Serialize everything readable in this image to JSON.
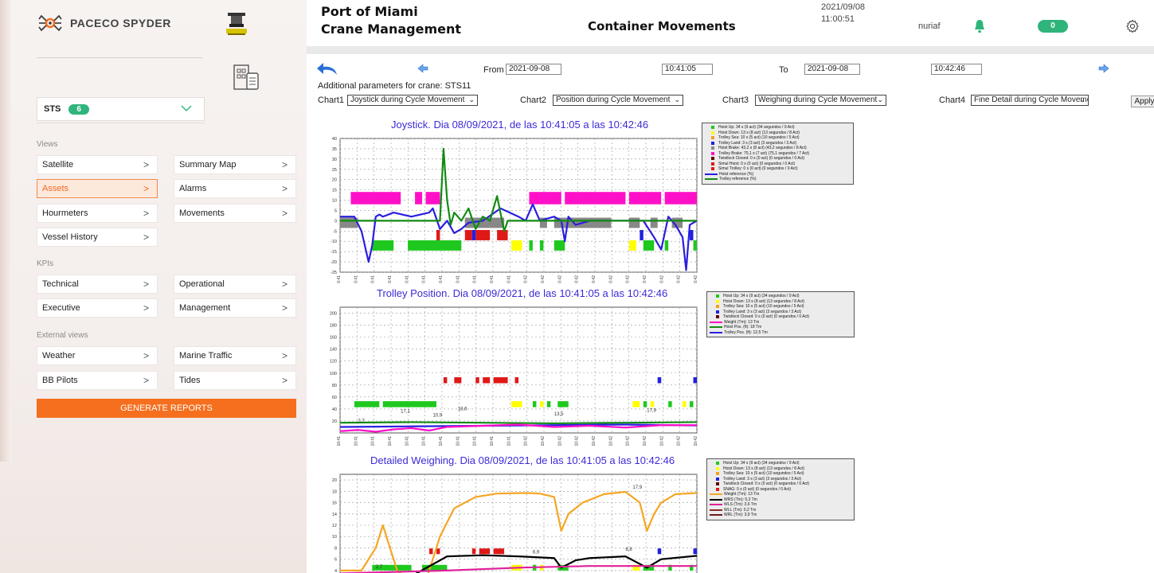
{
  "brand": {
    "name": "PACECO SPYDER"
  },
  "crane_selector": {
    "label": "STS",
    "count": "6"
  },
  "sections": {
    "views": "Views",
    "kpis": "KPIs",
    "external": "External views"
  },
  "nav": {
    "satellite": "Satellite",
    "summary_map": "Summary Map",
    "assets": "Assets",
    "alarms": "Alarms",
    "hourmeters": "Hourmeters",
    "movements": "Movements",
    "vessel_history": "Vessel History",
    "technical": "Technical",
    "operational": "Operational",
    "executive": "Executive",
    "management": "Management",
    "weather": "Weather",
    "marine_traffic": "Marine Traffic",
    "bb_pilots": "BB Pilots",
    "tides": "Tides",
    "arrow": ">"
  },
  "generate_reports": "GENERATE REPORTS",
  "header": {
    "port_line1": "Port of Miami",
    "port_line2": "Crane Management",
    "page_title": "Container Movements",
    "date": "2021/09/08",
    "time": "11:00:51",
    "user": "nuriaf",
    "notifications": "0"
  },
  "filters": {
    "from_label": "From",
    "from_date": "2021-09-08",
    "from_time": "10:41:05",
    "to_label": "To",
    "to_date": "2021-09-08",
    "to_time": "10:42:46",
    "additional": "Additional parameters for crane: STS11",
    "chart1_label": "Chart1",
    "chart1_value": "Joystick during Cycle Movement",
    "chart2_label": "Chart2",
    "chart2_value": "Position during Cycle Movement",
    "chart3_label": "Chart3",
    "chart3_value": "Weighing during Cycle Movement",
    "chart4_label": "Chart4",
    "chart4_value": "Fine Detail during Cycle Movement",
    "apply": "Apply"
  },
  "colors": {
    "accent": "#f56f1e",
    "green": "#2fb47c",
    "title_blue": "#3b2bd6"
  },
  "chart_data": [
    {
      "type": "line",
      "title": "Joystick. Dia 08/09/2021, de las 10:41:05 a las 10:42:46",
      "yticks": [
        "40",
        "35",
        "30",
        "25",
        "20",
        "15",
        "10",
        "5",
        "0",
        "-5",
        "-10",
        "-15",
        "-20",
        "-25"
      ],
      "ylim": [
        -25,
        40
      ],
      "xtick_labels": [
        "10:41",
        "10:41",
        "10:41",
        "10:41",
        "10:41",
        "10:41",
        "10:41",
        "10:41",
        "10:41",
        "10:41",
        "10:41",
        "10:42",
        "10:42",
        "10:42",
        "10:42",
        "10:42",
        "10:42",
        "10:42",
        "10:42",
        "10:42",
        "10:42",
        "10:42"
      ],
      "grid": true,
      "legend_position": "right",
      "legend": [
        {
          "label": "Hoist Up: 34 s (9 act) (34 segundos / 9 Act)",
          "color": "#1ec81e"
        },
        {
          "label": "Hoist Down: 13 s (8 act) (13 segundos / 8 Act)",
          "color": "#ffff00"
        },
        {
          "label": "Trolley Sea: 10 s (5 act) (10 segundos / 5 Act)",
          "color": "#f0a020"
        },
        {
          "label": "Trolley Land: 3 s (3 act) (3 segundos / 3 Act)",
          "color": "#2020e0"
        },
        {
          "label": "Hoist Brake: 43,2 s (8 act) (43,2 segundos / 8 Act)",
          "color": "#888888"
        },
        {
          "label": "Trolley Brake: 75,1 s (7 act) (75,1 segundos / 7 Act)",
          "color": "#ff10c8"
        },
        {
          "label": "Twistlock Closed: 0 s (0 act) (0 segundos / 0 Act)",
          "color": "#600000"
        },
        {
          "label": "Simul Hoist: 0 s (0 act) (0 segundos / 0 Act)",
          "color": "#e01818"
        },
        {
          "label": "Simul Trolley: 0 s (0 act) (0 segundos / 0 Act)",
          "color": "#e01818"
        },
        {
          "label": "Hoist reference (%)",
          "color": "#2a1ee0",
          "line": true
        },
        {
          "label": "Trolley reference (%)",
          "color": "#138a13",
          "line": true
        }
      ],
      "series": [
        {
          "name": "Hoist reference (%)",
          "color": "#2a1ee0",
          "x": [
            0,
            4,
            6,
            8,
            9,
            10,
            11,
            12,
            15,
            20,
            25,
            26,
            28,
            30,
            32,
            34,
            36,
            40,
            45,
            50,
            52,
            54,
            55,
            56,
            60,
            62,
            63,
            64,
            66,
            70,
            72,
            80,
            85,
            88,
            90,
            92,
            94,
            96,
            97,
            98,
            100
          ],
          "y": [
            2,
            2,
            -5,
            -20,
            -12,
            2,
            3,
            2,
            4,
            2,
            4,
            6,
            -4,
            0,
            -6,
            -4,
            -1,
            0,
            6,
            2,
            0,
            8,
            4,
            0,
            2,
            0,
            -10,
            2,
            -2,
            0,
            0,
            0,
            0,
            -8,
            -14,
            2,
            -2,
            -8,
            -24,
            -2,
            0
          ]
        },
        {
          "name": "Trolley reference (%)",
          "color": "#138a13",
          "x": [
            0,
            28,
            29,
            30,
            31,
            32,
            34,
            36,
            38,
            40,
            42,
            44,
            46,
            47,
            48,
            50,
            52,
            100
          ],
          "y": [
            0,
            0,
            35,
            10,
            -2,
            4,
            0,
            6,
            -4,
            2,
            0,
            12,
            -5,
            0,
            0,
            0,
            0,
            0
          ]
        }
      ]
    },
    {
      "type": "line",
      "title": "Trolley Position. Dia 08/09/2021, de las 10:41:05 a las 10:42:46",
      "yticks": [
        "200",
        "180",
        "160",
        "140",
        "120",
        "100",
        "80",
        "60",
        "40",
        "20"
      ],
      "ylim": [
        0,
        210
      ],
      "xtick_labels": [
        "10:41",
        "10:41",
        "10:41",
        "10:41",
        "10:41",
        "10:41",
        "10:41",
        "10:41",
        "10:41",
        "10:41",
        "10:41",
        "10:42",
        "10:42",
        "10:42",
        "10:42",
        "10:42",
        "10:42",
        "10:42",
        "10:42",
        "10:42",
        "10:42",
        "10:42"
      ],
      "annotations": [
        "17,1",
        "10,9",
        "18,6",
        "13,5",
        "17,9",
        "2,7"
      ],
      "grid": true,
      "legend_position": "right",
      "legend": [
        {
          "label": "Hoist Up: 34 s (9 act) (34 segundos / 9 Act)",
          "color": "#1ec81e"
        },
        {
          "label": "Hoist Down: 13 s (8 act) (13 segundos / 8 Act)",
          "color": "#ffff00"
        },
        {
          "label": "Trolley Sea: 10 s (5 act) (10 segundos / 5 Act)",
          "color": "#f0a020"
        },
        {
          "label": "Trolley Land: 3 s (3 act) (3 segundos / 3 Act)",
          "color": "#2020e0"
        },
        {
          "label": "Twistlock Closed: 0 s (0 act) (0 segundos / 0 Act)",
          "color": "#600000"
        },
        {
          "label": "Weight (Tm): 13 Tm",
          "color": "#ff10c8",
          "line": true
        },
        {
          "label": "Hoist Pos. (ft): 18 Tm",
          "color": "#138a13",
          "line": true
        },
        {
          "label": "Trolley Pos. (ft): 12,5 Tm",
          "color": "#2a1ee0",
          "line": true
        }
      ],
      "series": [
        {
          "name": "Hoist Pos. (ft): 18 Tm",
          "color": "#138a13",
          "x": [
            0,
            20,
            40,
            60,
            80,
            100
          ],
          "y": [
            17,
            18,
            17,
            16,
            17,
            18
          ]
        },
        {
          "name": "Trolley Pos. (ft): 12,5 Tm",
          "color": "#2a1ee0",
          "x": [
            0,
            20,
            40,
            60,
            80,
            100
          ],
          "y": [
            10,
            11,
            12,
            13,
            14,
            12.5
          ]
        },
        {
          "name": "Weight (Tm): 13 Tm",
          "color": "#ff10c8",
          "x": [
            0,
            5,
            10,
            15,
            20,
            25,
            30,
            40,
            50,
            60,
            70,
            80,
            90,
            100
          ],
          "y": [
            3,
            5,
            2,
            6,
            8,
            4,
            10,
            12,
            14,
            10,
            12,
            9,
            13,
            13
          ]
        }
      ]
    },
    {
      "type": "line",
      "title": "Detailed Weighing. Dia 08/09/2021, de las 10:41:05 a las 10:42:46",
      "yticks": [
        "20",
        "18",
        "16",
        "14",
        "12",
        "10",
        "8",
        "6",
        "4"
      ],
      "ylim": [
        3,
        21
      ],
      "annotations": [
        "17,9",
        "6,8",
        "6,9",
        "2,7"
      ],
      "grid": true,
      "legend_position": "right",
      "legend": [
        {
          "label": "Hoist Up: 34 s (9 act) (34 segundos / 9 Act)",
          "color": "#1ec81e"
        },
        {
          "label": "Hoist Down: 13 s (8 act) (13 segundos / 8 Act)",
          "color": "#ffff00"
        },
        {
          "label": "Trolley Sea: 10 s (5 act) (10 segundos / 5 Act)",
          "color": "#f0a020"
        },
        {
          "label": "Trolley Land: 3 s (3 act) (3 segundos / 3 Act)",
          "color": "#2020e0"
        },
        {
          "label": "Twistlock Closed: 0 s (0 act) (0 segundos / 0 Act)",
          "color": "#600000"
        },
        {
          "label": "SNAG: 0 s (0 act) (0 segundos / 0 Act)",
          "color": "#e01818"
        },
        {
          "label": "Weight (Tm): 13 Tm",
          "color": "#f5a623",
          "line": true
        },
        {
          "label": "WRS (Tm): 5,3 Tm",
          "color": "#000000",
          "line": true
        },
        {
          "label": "WLS (Tm): 3,6 Tm",
          "color": "#e0209a",
          "line": true
        },
        {
          "label": "WLL (Tm): 0,2 Tm",
          "color": "#8b2a2a",
          "line": true
        },
        {
          "label": "WRL (Tm): 3,9 Tm",
          "color": "#6a1a1a",
          "line": true
        }
      ],
      "series": [
        {
          "name": "Weight (Tm): 13 Tm",
          "color": "#f5a623",
          "x": [
            0,
            6,
            10,
            12,
            14,
            16,
            20,
            24,
            28,
            32,
            38,
            44,
            52,
            56,
            60,
            62,
            64,
            68,
            74,
            80,
            84,
            86,
            88,
            90,
            94,
            100
          ],
          "y": [
            4,
            4,
            8,
            12,
            8,
            4,
            2,
            2,
            10,
            15,
            17,
            17.6,
            17.7,
            17.6,
            17,
            11,
            14,
            16,
            17.5,
            17.9,
            16,
            11,
            14,
            16,
            17.5,
            17.7
          ]
        },
        {
          "name": "WRS (Tm): 5,3 Tm",
          "color": "#000000",
          "x": [
            0,
            20,
            30,
            40,
            50,
            60,
            62,
            66,
            70,
            80,
            86,
            90,
            100
          ],
          "y": [
            3,
            3,
            6.5,
            6.7,
            6.5,
            6.2,
            4.5,
            5.8,
            6.2,
            6.5,
            4.5,
            6,
            6.6
          ]
        },
        {
          "name": "WLS (Tm): 3,6 Tm",
          "color": "#e0209a",
          "x": [
            0,
            30,
            50,
            70,
            100
          ],
          "y": [
            3.5,
            4,
            4.5,
            4.8,
            4.8
          ]
        }
      ]
    }
  ]
}
